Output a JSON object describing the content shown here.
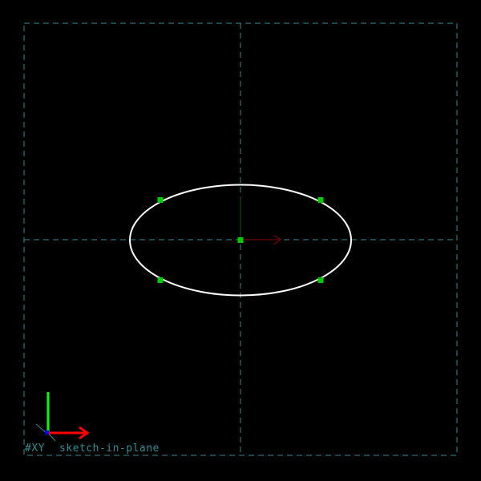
{
  "plane": {
    "name": "#XY",
    "caption": "sketch-in-plane"
  },
  "colors": {
    "background": "#000000",
    "guide": "#2b8f95",
    "curve": "#ffffff",
    "handle": "#00cc00",
    "axis_x": "#ff0000",
    "axis_y": "#00ff00",
    "axis_z": "#0000ff",
    "direction_x": "#8b0000",
    "direction_y": "#006400"
  },
  "sketch": {
    "entities": [
      {
        "type": "ellipse",
        "name": "ellipse"
      }
    ],
    "handles": [
      {
        "name": "center-point-handle",
        "role": "center"
      },
      {
        "name": "control-point-handle",
        "role": "top-left"
      },
      {
        "name": "control-point-handle",
        "role": "top-right"
      },
      {
        "name": "control-point-handle",
        "role": "bottom-left"
      },
      {
        "name": "control-point-handle",
        "role": "bottom-right"
      }
    ]
  },
  "icons": {
    "triad": "axis-triad-icon",
    "direction": "direction-arrow-icon"
  }
}
